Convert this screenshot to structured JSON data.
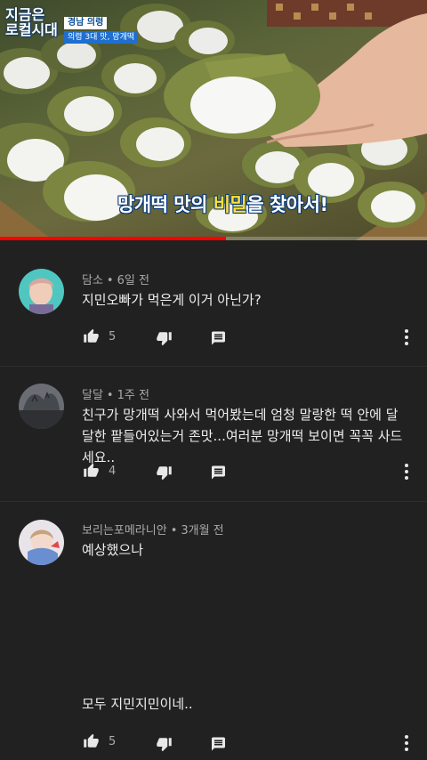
{
  "video": {
    "show_logo_line1": "지금은",
    "show_logo_line2": "로컬시대",
    "location": "경남 의령",
    "subtitle_tag": "의령 3대 맛, 망개떡",
    "caption_part1": "망개떡 맛의 ",
    "caption_highlight": "비밀",
    "caption_part2": "을 찾아서!",
    "progress_fraction": 0.53,
    "accent_color": "#ff0000"
  },
  "comments": [
    {
      "author": "담소",
      "time": "6일 전",
      "text": "지민오빠가 먹은게 이거 아닌가?",
      "likes": "5"
    },
    {
      "author": "달달",
      "time": "1주 전",
      "text": "친구가 망개떡 사와서 먹어봤는데 엄청 말랑한 떡 안에 달달한 팥들어있는거 존맛...여러분 망개떡 보이면 꼭꼭 사드세요..",
      "likes": "4"
    },
    {
      "author": "보리는포메라니안",
      "time": "3개월 전",
      "text_line1": "예상했으나",
      "text_line2": "모두 지민지민이네..",
      "likes": "5"
    }
  ],
  "icons": {
    "like": "thumbs-up-icon",
    "dislike": "thumbs-down-icon",
    "reply": "reply-icon",
    "more": "more-vert-icon"
  }
}
